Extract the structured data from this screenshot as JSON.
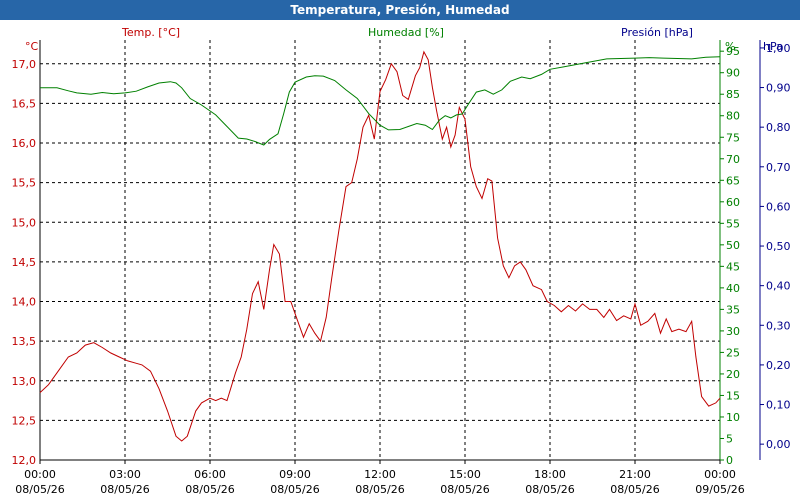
{
  "window": {
    "title": "Temperatura, Presión, Humedad"
  },
  "colors": {
    "temperature": "#c00000",
    "humidity": "#008000",
    "pressure": "#00008b",
    "title_bar": "#2766a8"
  },
  "chart_data": {
    "type": "line",
    "title": "Temperatura, Presión, Humedad",
    "grid": true,
    "x_ticks": [
      {
        "time": "00:00",
        "date": "08/05/26"
      },
      {
        "time": "03:00",
        "date": "08/05/26"
      },
      {
        "time": "06:00",
        "date": "08/05/26"
      },
      {
        "time": "09:00",
        "date": "08/05/26"
      },
      {
        "time": "12:00",
        "date": "08/05/26"
      },
      {
        "time": "15:00",
        "date": "08/05/26"
      },
      {
        "time": "18:00",
        "date": "08/05/26"
      },
      {
        "time": "21:00",
        "date": "08/05/26"
      },
      {
        "time": "00:00",
        "date": "09/05/26"
      }
    ],
    "axes": {
      "temperature": {
        "unit": "°C",
        "label": "Temp. [°C]",
        "range": [
          12.0,
          17.3
        ],
        "ticks": [
          "12,0",
          "12,5",
          "13,0",
          "13,5",
          "14,0",
          "14,5",
          "15,0",
          "15,5",
          "16,0",
          "16,5",
          "17,0"
        ]
      },
      "humidity": {
        "unit": "%",
        "label": "Humedad [%]",
        "range": [
          0,
          97.6
        ],
        "ticks": [
          "0",
          "5",
          "10",
          "15",
          "20",
          "25",
          "30",
          "35",
          "40",
          "45",
          "50",
          "55",
          "60",
          "65",
          "70",
          "75",
          "80",
          "85",
          "90",
          "95"
        ]
      },
      "pressure": {
        "unit": "hPa",
        "label": "Presión [hPa]",
        "range": [
          -0.04,
          1.02
        ],
        "ticks": [
          "0,00",
          "0,10",
          "0,20",
          "0,30",
          "0,40",
          "0,50",
          "0,60",
          "0,70",
          "0,80",
          "0,90",
          "1,00"
        ]
      }
    },
    "series": [
      {
        "name": "Temp. [°C]",
        "axis": "temperature",
        "points": [
          [
            0,
            12.85
          ],
          [
            0.3,
            12.95
          ],
          [
            0.6,
            13.1
          ],
          [
            1.0,
            13.3
          ],
          [
            1.3,
            13.35
          ],
          [
            1.6,
            13.45
          ],
          [
            1.9,
            13.48
          ],
          [
            2.2,
            13.42
          ],
          [
            2.5,
            13.35
          ],
          [
            2.8,
            13.3
          ],
          [
            3.1,
            13.25
          ],
          [
            3.4,
            13.22
          ],
          [
            3.6,
            13.2
          ],
          [
            3.9,
            13.12
          ],
          [
            4.2,
            12.9
          ],
          [
            4.5,
            12.62
          ],
          [
            4.8,
            12.3
          ],
          [
            5.0,
            12.24
          ],
          [
            5.2,
            12.3
          ],
          [
            5.5,
            12.62
          ],
          [
            5.7,
            12.72
          ],
          [
            6.0,
            12.78
          ],
          [
            6.2,
            12.75
          ],
          [
            6.4,
            12.78
          ],
          [
            6.6,
            12.75
          ],
          [
            6.9,
            13.1
          ],
          [
            7.1,
            13.3
          ],
          [
            7.3,
            13.65
          ],
          [
            7.5,
            14.1
          ],
          [
            7.7,
            14.25
          ],
          [
            7.9,
            13.9
          ],
          [
            8.1,
            14.4
          ],
          [
            8.25,
            14.72
          ],
          [
            8.45,
            14.6
          ],
          [
            8.65,
            14.0
          ],
          [
            8.85,
            14.0
          ],
          [
            9.05,
            13.8
          ],
          [
            9.3,
            13.55
          ],
          [
            9.5,
            13.72
          ],
          [
            9.7,
            13.6
          ],
          [
            9.9,
            13.5
          ],
          [
            10.1,
            13.8
          ],
          [
            10.3,
            14.3
          ],
          [
            10.55,
            14.9
          ],
          [
            10.8,
            15.45
          ],
          [
            11.0,
            15.5
          ],
          [
            11.2,
            15.8
          ],
          [
            11.4,
            16.2
          ],
          [
            11.6,
            16.35
          ],
          [
            11.8,
            16.05
          ],
          [
            12.0,
            16.65
          ],
          [
            12.2,
            16.8
          ],
          [
            12.4,
            17.0
          ],
          [
            12.6,
            16.9
          ],
          [
            12.8,
            16.6
          ],
          [
            13.0,
            16.55
          ],
          [
            13.25,
            16.85
          ],
          [
            13.4,
            16.95
          ],
          [
            13.55,
            17.15
          ],
          [
            13.7,
            17.05
          ],
          [
            13.85,
            16.7
          ],
          [
            14.0,
            16.4
          ],
          [
            14.2,
            16.05
          ],
          [
            14.35,
            16.2
          ],
          [
            14.5,
            15.95
          ],
          [
            14.65,
            16.1
          ],
          [
            14.8,
            16.45
          ],
          [
            15.0,
            16.3
          ],
          [
            15.2,
            15.7
          ],
          [
            15.4,
            15.45
          ],
          [
            15.6,
            15.3
          ],
          [
            15.8,
            15.55
          ],
          [
            15.95,
            15.52
          ],
          [
            16.15,
            14.8
          ],
          [
            16.35,
            14.45
          ],
          [
            16.55,
            14.3
          ],
          [
            16.75,
            14.45
          ],
          [
            16.95,
            14.5
          ],
          [
            17.15,
            14.4
          ],
          [
            17.4,
            14.2
          ],
          [
            17.7,
            14.15
          ],
          [
            17.9,
            14.0
          ],
          [
            18.15,
            13.95
          ],
          [
            18.4,
            13.87
          ],
          [
            18.65,
            13.95
          ],
          [
            18.9,
            13.88
          ],
          [
            19.15,
            13.97
          ],
          [
            19.4,
            13.9
          ],
          [
            19.65,
            13.9
          ],
          [
            19.9,
            13.8
          ],
          [
            20.1,
            13.9
          ],
          [
            20.35,
            13.76
          ],
          [
            20.6,
            13.82
          ],
          [
            20.85,
            13.78
          ],
          [
            21.0,
            13.97
          ],
          [
            21.2,
            13.7
          ],
          [
            21.45,
            13.75
          ],
          [
            21.7,
            13.85
          ],
          [
            21.9,
            13.6
          ],
          [
            22.1,
            13.78
          ],
          [
            22.3,
            13.62
          ],
          [
            22.55,
            13.65
          ],
          [
            22.8,
            13.62
          ],
          [
            23.0,
            13.75
          ],
          [
            23.15,
            13.3
          ],
          [
            23.35,
            12.8
          ],
          [
            23.6,
            12.68
          ],
          [
            23.85,
            12.72
          ],
          [
            24.0,
            12.78
          ]
        ]
      },
      {
        "name": "Humedad [%]",
        "axis": "humidity",
        "points": [
          [
            0,
            86.5
          ],
          [
            0.6,
            86.5
          ],
          [
            1.0,
            85.8
          ],
          [
            1.3,
            85.3
          ],
          [
            1.8,
            85.0
          ],
          [
            2.2,
            85.4
          ],
          [
            2.6,
            85.1
          ],
          [
            3.0,
            85.3
          ],
          [
            3.4,
            85.7
          ],
          [
            3.8,
            86.7
          ],
          [
            4.2,
            87.6
          ],
          [
            4.6,
            87.9
          ],
          [
            4.8,
            87.6
          ],
          [
            5.0,
            86.5
          ],
          [
            5.3,
            84.0
          ],
          [
            5.7,
            82.5
          ],
          [
            6.2,
            80.2
          ],
          [
            6.6,
            77.5
          ],
          [
            7.0,
            74.8
          ],
          [
            7.3,
            74.6
          ],
          [
            7.6,
            74.0
          ],
          [
            7.9,
            73.2
          ],
          [
            8.1,
            74.5
          ],
          [
            8.4,
            75.8
          ],
          [
            8.6,
            80.5
          ],
          [
            8.8,
            85.5
          ],
          [
            9.0,
            87.8
          ],
          [
            9.4,
            89.0
          ],
          [
            9.7,
            89.3
          ],
          [
            10.0,
            89.2
          ],
          [
            10.4,
            88.2
          ],
          [
            10.8,
            86.0
          ],
          [
            11.2,
            84.0
          ],
          [
            11.6,
            80.5
          ],
          [
            12.0,
            77.8
          ],
          [
            12.3,
            76.7
          ],
          [
            12.7,
            76.8
          ],
          [
            13.0,
            77.5
          ],
          [
            13.3,
            78.2
          ],
          [
            13.6,
            77.8
          ],
          [
            13.85,
            76.8
          ],
          [
            14.1,
            79.0
          ],
          [
            14.3,
            80.0
          ],
          [
            14.5,
            79.5
          ],
          [
            14.7,
            80.2
          ],
          [
            14.9,
            80.4
          ],
          [
            15.1,
            82.5
          ],
          [
            15.4,
            85.5
          ],
          [
            15.7,
            86.0
          ],
          [
            16.0,
            85.0
          ],
          [
            16.3,
            86.0
          ],
          [
            16.6,
            88.0
          ],
          [
            17.0,
            89.0
          ],
          [
            17.3,
            88.6
          ],
          [
            17.7,
            89.6
          ],
          [
            18.0,
            90.8
          ],
          [
            18.5,
            91.4
          ],
          [
            19.0,
            92.0
          ],
          [
            19.5,
            92.6
          ],
          [
            20.0,
            93.2
          ],
          [
            20.5,
            93.3
          ],
          [
            21.0,
            93.4
          ],
          [
            21.5,
            93.5
          ],
          [
            22.0,
            93.4
          ],
          [
            22.5,
            93.3
          ],
          [
            23.0,
            93.2
          ],
          [
            23.5,
            93.6
          ],
          [
            24.0,
            93.7
          ]
        ]
      }
    ]
  }
}
